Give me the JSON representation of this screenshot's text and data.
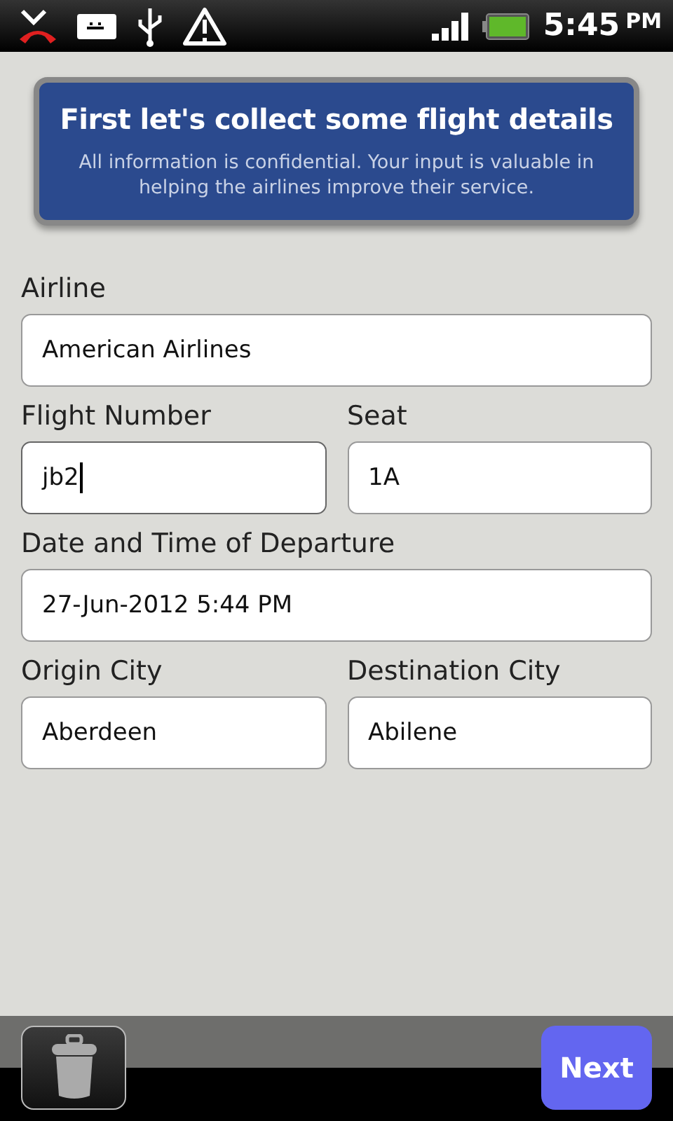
{
  "status_bar": {
    "time": "5:45",
    "ampm": "PM"
  },
  "header": {
    "title": "First let's collect some flight details",
    "subtitle": "All information is confidential. Your input is valuable in helping the airlines improve their service."
  },
  "form_rows": [
    {
      "fields": [
        {
          "label": "Airline",
          "value": "American Airlines",
          "focused": false
        }
      ]
    },
    {
      "fields": [
        {
          "label": "Flight Number",
          "value": "jb2",
          "focused": true
        },
        {
          "label": "Seat",
          "value": "1A",
          "focused": false
        }
      ]
    },
    {
      "fields": [
        {
          "label": "Date and Time of Departure",
          "value": "27-Jun-2012 5:44 PM",
          "focused": false
        }
      ]
    },
    {
      "fields": [
        {
          "label": "Origin City",
          "value": "Aberdeen",
          "focused": false
        },
        {
          "label": "Destination City",
          "value": "Abilene",
          "focused": false
        }
      ]
    }
  ],
  "bottom_bar": {
    "next_button": "Next"
  }
}
